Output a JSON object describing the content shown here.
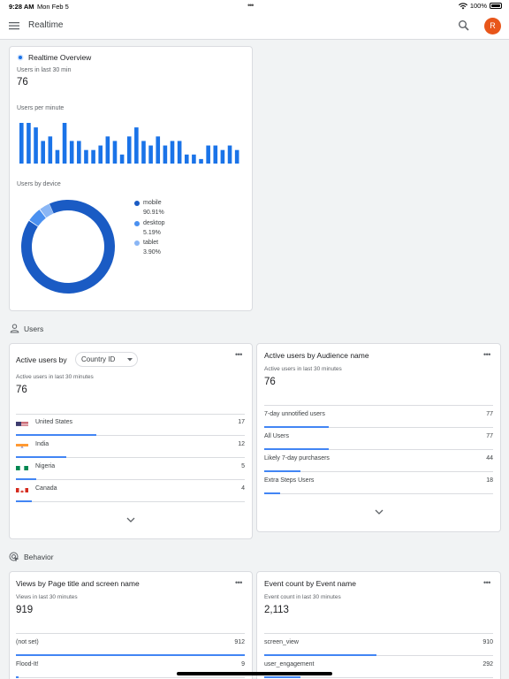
{
  "status_bar": {
    "time": "9:28 AM",
    "date": "Mon Feb 5",
    "dots": "•••",
    "battery": "100%"
  },
  "topbar": {
    "title": "Realtime",
    "avatar_letter": "R"
  },
  "overview": {
    "title": "Realtime Overview",
    "users_label": "Users in last 30 min",
    "users_value": "76",
    "per_minute_label": "Users per minute",
    "per_minute_values": [
      9,
      9,
      8,
      5,
      6,
      3,
      9,
      5,
      5,
      3,
      3,
      4,
      6,
      5,
      2,
      6,
      8,
      5,
      4,
      6,
      4,
      5,
      5,
      2,
      2,
      1,
      4,
      4,
      3,
      4,
      3
    ],
    "device_label": "Users by device",
    "devices": [
      {
        "name": "mobile",
        "pct": "90.91%",
        "value": 90.91,
        "color": "#1a5bc4"
      },
      {
        "name": "desktop",
        "pct": "5.19%",
        "value": 5.19,
        "color": "#4a90f0"
      },
      {
        "name": "tablet",
        "pct": "3.90%",
        "value": 3.9,
        "color": "#8ab6f5"
      }
    ]
  },
  "users_section": {
    "title": "Users"
  },
  "country_card": {
    "title": "Active users by",
    "dropdown": "Country ID",
    "metric_label": "Active users in last 30 minutes",
    "metric_value": "76",
    "rows": [
      {
        "name": "United States",
        "value": "17",
        "fraction": 0.35
      },
      {
        "name": "India",
        "value": "12",
        "fraction": 0.22
      },
      {
        "name": "Nigeria",
        "value": "5",
        "fraction": 0.09
      },
      {
        "name": "Canada",
        "value": "4",
        "fraction": 0.07
      }
    ]
  },
  "audience_card": {
    "title": "Active users by Audience name",
    "metric_label": "Active users in last 30 minutes",
    "metric_value": "76",
    "rows": [
      {
        "name": "7-day unnotified users",
        "value": "77",
        "fraction": 0.28
      },
      {
        "name": "All Users",
        "value": "77",
        "fraction": 0.28
      },
      {
        "name": "Likely 7-day purchasers",
        "value": "44",
        "fraction": 0.16
      },
      {
        "name": "Extra Steps Users",
        "value": "18",
        "fraction": 0.07
      }
    ]
  },
  "behavior_section": {
    "title": "Behavior"
  },
  "views_card": {
    "title": "Views by Page title and screen name",
    "metric_label": "Views in last 30 minutes",
    "metric_value": "919",
    "rows": [
      {
        "name": "(not set)",
        "value": "912",
        "fraction": 1.0
      },
      {
        "name": "Flood-It!",
        "value": "9",
        "fraction": 0.01
      }
    ]
  },
  "events_card": {
    "title": "Event count by Event name",
    "metric_label": "Event count in last 30 minutes",
    "metric_value": "2,113",
    "rows": [
      {
        "name": "screen_view",
        "value": "910",
        "fraction": 0.49
      },
      {
        "name": "user_engagement",
        "value": "292",
        "fraction": 0.16
      }
    ]
  },
  "more_glyph": "•••"
}
